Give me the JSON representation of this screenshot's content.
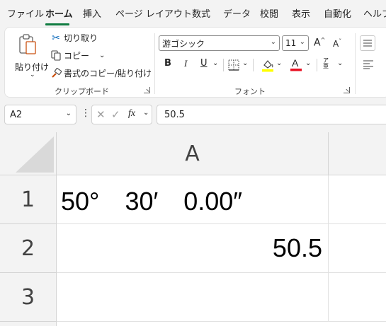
{
  "menu": {
    "tabs": [
      "ファイル",
      "ホーム",
      "挿入",
      "ページ レイアウト",
      "数式",
      "データ",
      "校閲",
      "表示",
      "自動化",
      "ヘルプ"
    ],
    "active": "ホーム"
  },
  "ribbon": {
    "clipboard": {
      "paste_label": "貼り付け",
      "cut_label": "切り取り",
      "copy_label": "コピー",
      "format_painter_label": "書式のコピー/貼り付け",
      "group_label": "クリップボード"
    },
    "font": {
      "font_name": "游ゴシック",
      "font_size": "11",
      "bold": "B",
      "italic": "I",
      "underline": "U",
      "group_label": "フォント",
      "fill_color": "#ffff00",
      "font_color": "#e81123"
    }
  },
  "formula_bar": {
    "name_box": "A2",
    "fx_label": "fx",
    "value": "50.5"
  },
  "grid": {
    "column_headers": [
      "A"
    ],
    "row_headers": [
      "1",
      "2",
      "3"
    ],
    "cells": {
      "A1": "50°　30′　0.00″",
      "A2": "50.5",
      "A3": ""
    }
  }
}
